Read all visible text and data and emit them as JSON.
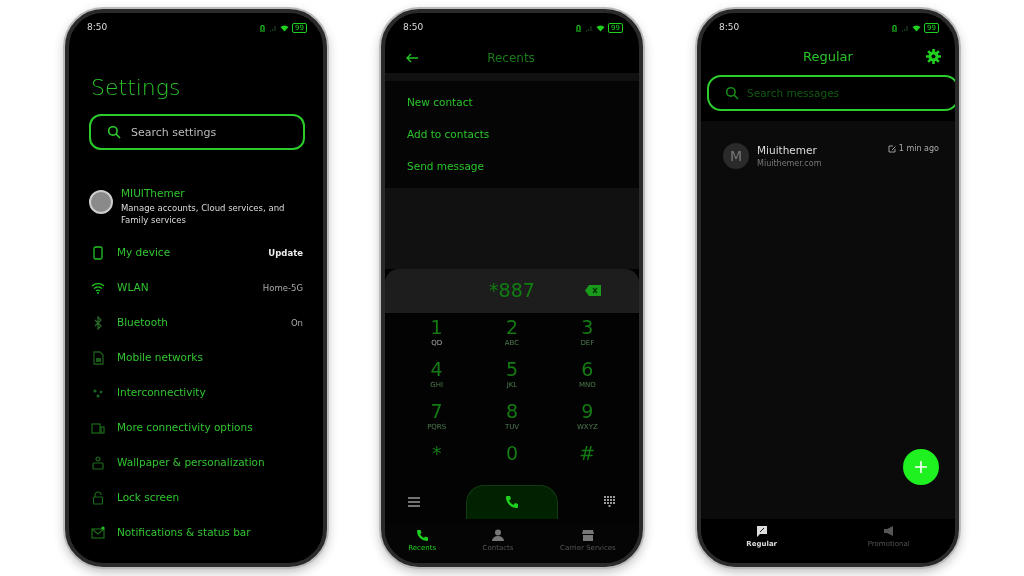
{
  "phones": [
    {
      "kind": "settings",
      "status": {
        "time": "8:50",
        "battery": "99"
      },
      "title": "Settings",
      "search": {
        "placeholder": "Search settings"
      },
      "account": {
        "name": "MIUIThemer",
        "description": "Manage accounts, Cloud services, and Family services"
      },
      "items": [
        {
          "label": "My device",
          "value": "Update",
          "value_bold": true
        },
        {
          "label": "WLAN",
          "value": "Home-5G",
          "value_bold": false
        },
        {
          "label": "Bluetooth",
          "value": "On",
          "value_bold": false
        },
        {
          "label": "Mobile networks"
        },
        {
          "label": "Interconnectivity"
        },
        {
          "label": "More connectivity options"
        },
        {
          "label": "Wallpaper & personalization"
        },
        {
          "label": "Lock screen"
        },
        {
          "label": "Notifications & status bar"
        }
      ]
    },
    {
      "kind": "dialer",
      "status": {
        "time": "8:50",
        "battery": "99"
      },
      "title": "Recents",
      "menu": [
        "New contact",
        "Add to contacts",
        "Send message"
      ],
      "number": "*887",
      "keys": [
        {
          "digit": "1",
          "letters": "QD"
        },
        {
          "digit": "2",
          "letters": "ABC"
        },
        {
          "digit": "3",
          "letters": "DEF"
        },
        {
          "digit": "4",
          "letters": "GHI"
        },
        {
          "digit": "5",
          "letters": "JKL"
        },
        {
          "digit": "6",
          "letters": "MNO"
        },
        {
          "digit": "7",
          "letters": "PQRS"
        },
        {
          "digit": "8",
          "letters": "TUV"
        },
        {
          "digit": "9",
          "letters": "WXYZ"
        },
        {
          "digit": "*"
        },
        {
          "digit": "0"
        },
        {
          "digit": "#"
        }
      ],
      "tabs": [
        {
          "label": "Recents",
          "selected": true
        },
        {
          "label": "Contacts",
          "selected": false
        },
        {
          "label": "Carrier Services",
          "selected": false
        }
      ]
    },
    {
      "kind": "messages",
      "status": {
        "time": "8:50",
        "battery": "99"
      },
      "title": "Regular",
      "search": {
        "placeholder": "Search messages"
      },
      "conversations": [
        {
          "initial": "M",
          "name": "Miuithemer",
          "preview": "Miuithemer.com",
          "time": "1 min ago"
        }
      ],
      "tabs": [
        {
          "label": "Regular",
          "selected": true
        },
        {
          "label": "Promotional",
          "selected": false
        }
      ]
    }
  ]
}
